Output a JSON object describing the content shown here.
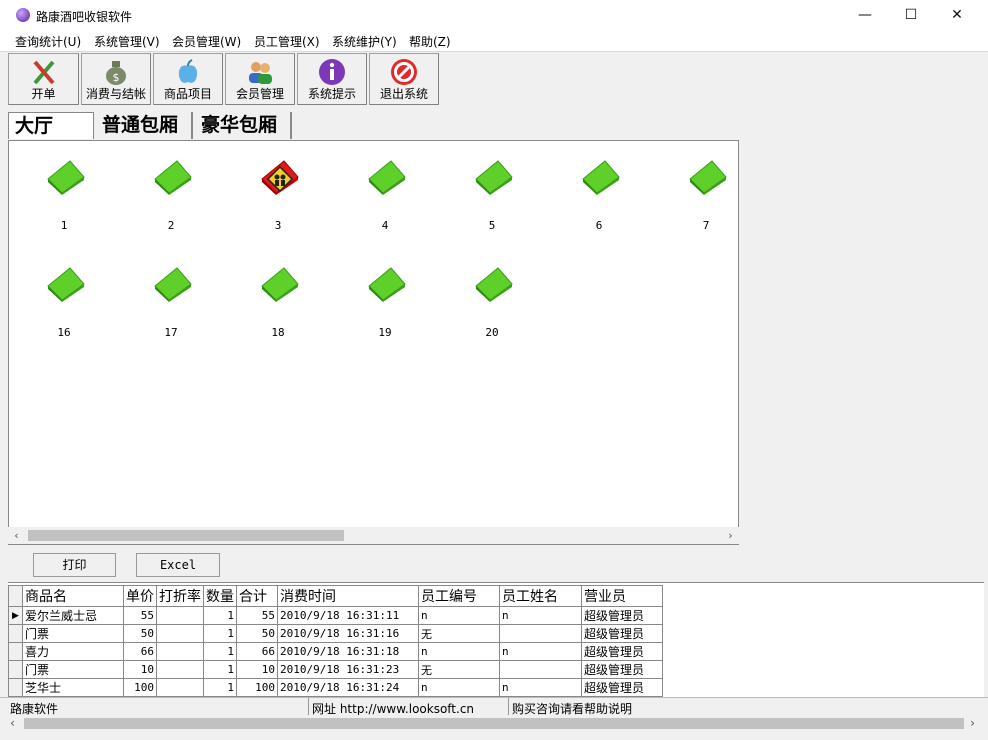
{
  "window": {
    "title": "路康酒吧收银软件",
    "minimize": "—",
    "maximize": "☐",
    "close": "✕"
  },
  "menu": [
    "查询统计(U)",
    "系统管理(V)",
    "会员管理(W)",
    "员工管理(X)",
    "系统维护(Y)",
    "帮助(Z)"
  ],
  "toolbar": [
    {
      "label": "开单",
      "icon": "pen-brush-icon"
    },
    {
      "label": "消费与结帐",
      "icon": "money-bag-icon"
    },
    {
      "label": "商品项目",
      "icon": "apple-icon"
    },
    {
      "label": "会员管理",
      "icon": "members-icon"
    },
    {
      "label": "系统提示",
      "icon": "info-icon"
    },
    {
      "label": "退出系统",
      "icon": "exit-icon"
    }
  ],
  "tabs": [
    "大厅",
    "普通包厢",
    "豪华包厢"
  ],
  "rooms": [
    {
      "num": "1",
      "status": "free"
    },
    {
      "num": "2",
      "status": "free"
    },
    {
      "num": "3",
      "status": "occupied"
    },
    {
      "num": "4",
      "status": "free"
    },
    {
      "num": "5",
      "status": "free"
    },
    {
      "num": "6",
      "status": "free"
    },
    {
      "num": "7",
      "status": "free"
    },
    {
      "num": "16",
      "status": "free"
    },
    {
      "num": "17",
      "status": "free"
    },
    {
      "num": "18",
      "status": "free"
    },
    {
      "num": "19",
      "status": "free"
    },
    {
      "num": "20",
      "status": "free"
    }
  ],
  "colors": {
    "free": "#5fd02a",
    "occupied": "#e01818"
  },
  "buttons": {
    "print": "打印",
    "excel": "Excel"
  },
  "table": {
    "headers": [
      "商品名",
      "单价",
      "打折率",
      "数量",
      "合计",
      "消费时间",
      "员工编号",
      "员工姓名",
      "营业员"
    ],
    "rows": [
      [
        "爱尔兰威士忌",
        "55",
        "",
        "1",
        "55",
        "2010/9/18 16:31:11",
        "n",
        "n",
        "超级管理员"
      ],
      [
        "门票",
        "50",
        "",
        "1",
        "50",
        "2010/9/18 16:31:16",
        "无",
        "",
        "超级管理员"
      ],
      [
        "喜力",
        "66",
        "",
        "1",
        "66",
        "2010/9/18 16:31:18",
        "n",
        "n",
        "超级管理员"
      ],
      [
        "门票",
        "10",
        "",
        "1",
        "10",
        "2010/9/18 16:31:23",
        "无",
        "",
        "超级管理员"
      ],
      [
        "芝华士",
        "100",
        "",
        "1",
        "100",
        "2010/9/18 16:31:24",
        "n",
        "n",
        "超级管理员"
      ]
    ]
  },
  "status": [
    "路康软件",
    "网址 http://www.looksoft.cn",
    "购买咨询请看帮助说明"
  ]
}
